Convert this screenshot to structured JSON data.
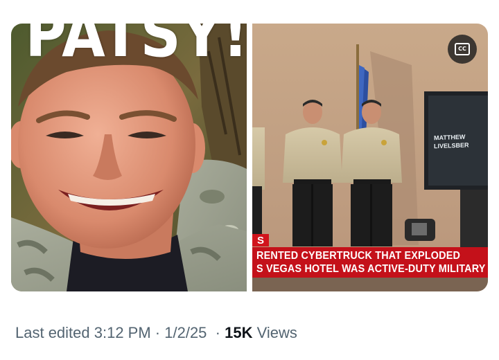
{
  "media": {
    "left_image": {
      "overlay_text": "PATSY!",
      "alt": "Smiling man in camouflage uniform"
    },
    "right_video": {
      "cc_label": "CC",
      "screen_text": [
        "MATTHEW",
        "LIVELSBER"
      ],
      "chyron_tag": "S",
      "chyron_lines": [
        "RENTED CYBERTRUCK THAT EXPLODED",
        "S VEGAS HOTEL WAS ACTIVE-DUTY MILITARY"
      ]
    }
  },
  "post_meta": {
    "edited_label": "Last edited 3:12 PM",
    "separator": " · ",
    "date": "1/2/25",
    "separator2": "  · ",
    "views_count": "15K",
    "views_label": " Views"
  },
  "colors": {
    "chyron_red": "#c4111a",
    "meta_gray": "#536471",
    "text_dark": "#0f1419"
  }
}
